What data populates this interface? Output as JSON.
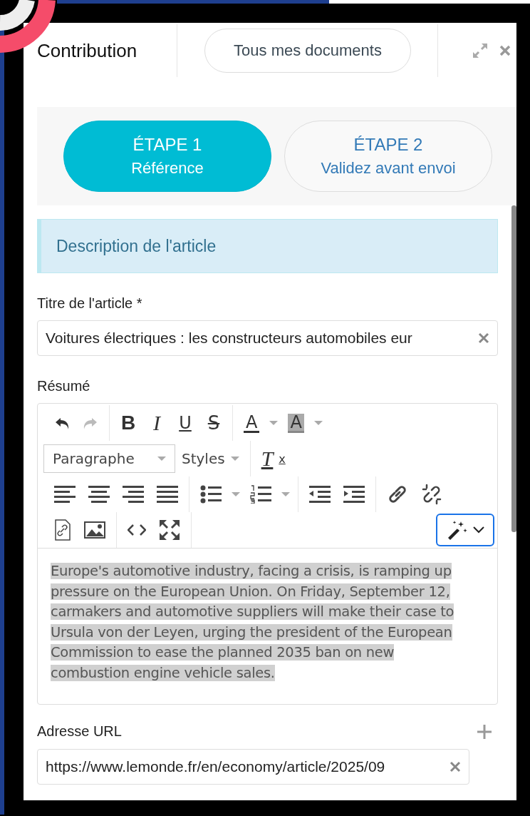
{
  "header": {
    "title": "Contribution",
    "documents_button": "Tous mes documents"
  },
  "steps": [
    {
      "title": "ÉTAPE 1",
      "subtitle": "Référence",
      "selected": true
    },
    {
      "title": "ÉTAPE 2",
      "subtitle": "Validez avant envoi",
      "selected": false
    }
  ],
  "section_banner": "Description de l'article",
  "title_field": {
    "label": "Titre de l'article *",
    "value": "Voitures électriques : les constructeurs automobiles eur"
  },
  "summary": {
    "label": "Résumé",
    "toolbar": {
      "undo_disabled": false,
      "redo_disabled": true,
      "bold": "B",
      "italic": "I",
      "underline": "U",
      "strikethrough": "S",
      "text_color": "A",
      "background_color": "A",
      "format_select": "Paragraphe",
      "styles_menu": "Styles",
      "clear_format": "T",
      "clear_format_mark": "x",
      "ai_button_focused": true
    },
    "text": "Europe's automotive industry, facing a crisis, is ramping up pressure on the European Union. On Friday, September 12, carmakers and automotive suppliers will make their case to Ursula von der Leyen, urging the president of the European Commission to ease the planned 2035 ban on new combustion engine vehicle sales.",
    "text_selected": true
  },
  "url_field": {
    "label": "Adresse URL",
    "value": "https://www.lemonde.fr/en/economy/article/2025/09"
  }
}
